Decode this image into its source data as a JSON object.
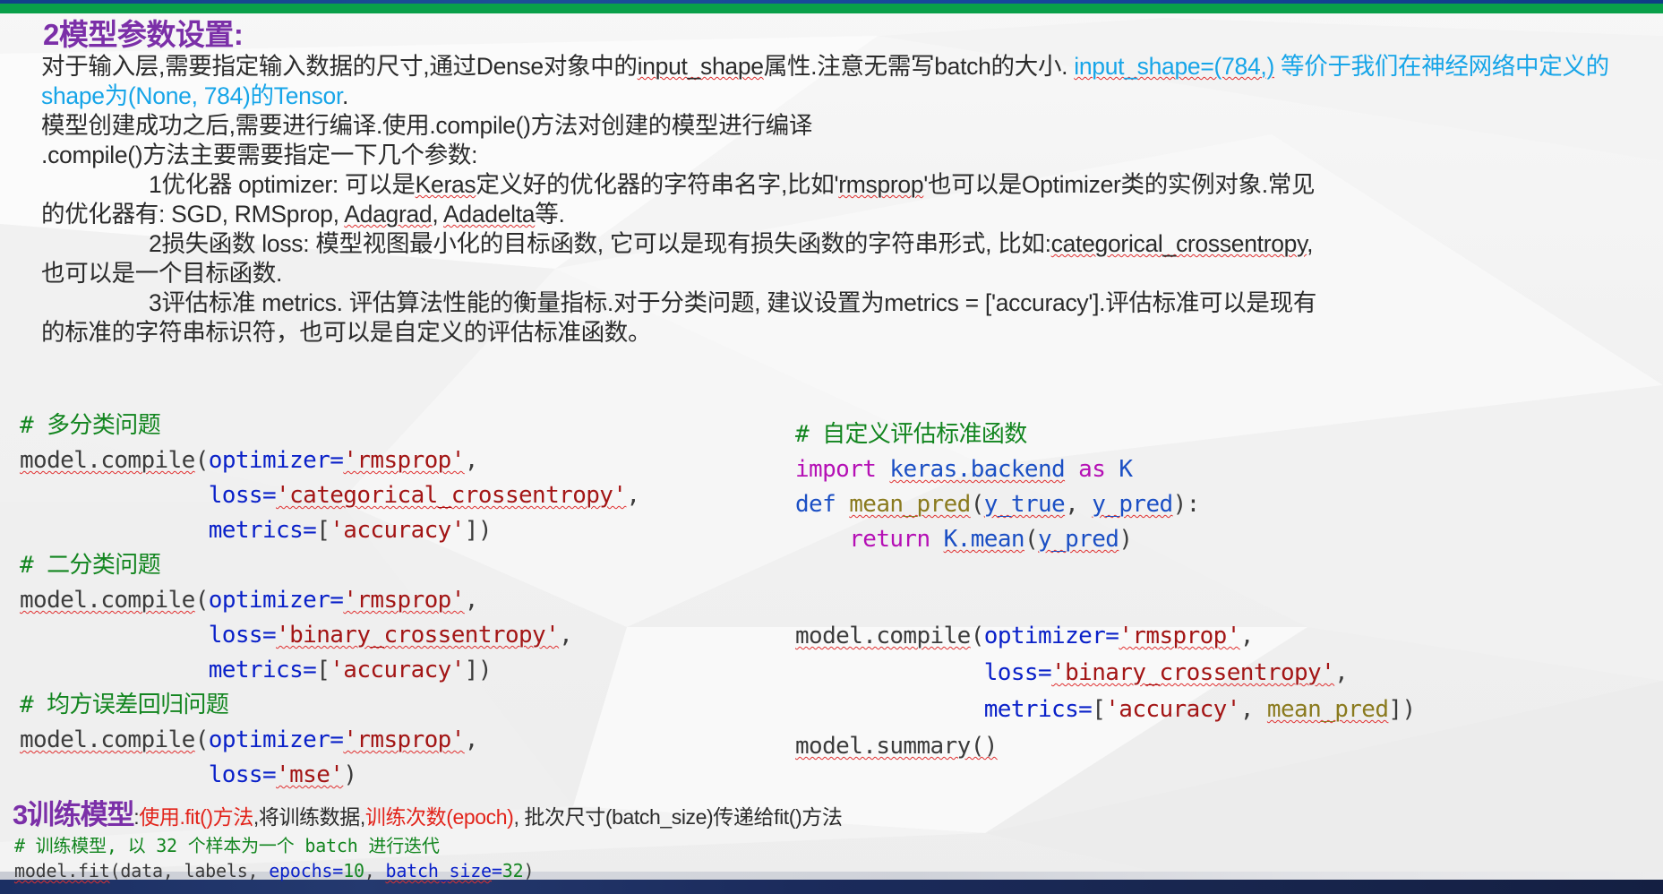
{
  "slide": {
    "accent_purple": "#7b2fa8",
    "accent_green": "#09a04a",
    "accent_navy": "#1b2f63",
    "link_blue": "#17a5e8",
    "alert_red": "#e2231a"
  },
  "heading2": "2模型参数设置:",
  "paragraph": {
    "line1_a": "对于输入层,需要指定输入数据的尺寸,通过Dense对象中的",
    "line1_b": "input_shape",
    "line1_c": "属性.注意无需写batch的大小. ",
    "line1_blue_a": "input_shape=(784,)",
    "line1_blue_b": " 等价于我们在神经网络中定义的shape为(None, 784)的Tensor",
    "line1_end": ".",
    "line2": "模型创建成功之后,需要进行编译.使用.compile()方法对创建的模型进行编译",
    "line3": ".compile()方法主要需要指定一下几个参数:",
    "item1_a": "1优化器 optimizer: 可以是",
    "item1_keras": "Keras",
    "item1_b": "定义好的优化器的字符串名字,比如'",
    "item1_rmsprop": "rmsprop",
    "item1_c": "'也可以是Optimizer类的实例对象.常见",
    "item1_d": "的优化器有: SGD, RMSprop, ",
    "item1_adagrad": "Adagrad",
    "item1_e": ", ",
    "item1_adadelta": "Adadelta",
    "item1_f": "等.",
    "item2_a": "2损失函数 loss: 模型视图最小化的目标函数, 它可以是现有损失函数的字符串形式, 比如:",
    "item2_cat": "categorical_crossentropy",
    "item2_b": ",",
    "item2_c": "也可以是一个目标函数.",
    "item3_a": "3评估标准 metrics. 评估算法性能的衡量指标.对于分类问题, 建议设置为metrics = ['accuracy'].评估标准可以是现有",
    "item3_b": "的标准的字符串标识符，也可以是自定义的评估标准函数。"
  },
  "code_left": {
    "comment1": "# 多分类问题",
    "b1_call": "model.compile",
    "b1_open": "(",
    "b1_kw1": "optimizer",
    "b1_eq": "=",
    "b1_s1": "'rmsprop'",
    "b1_comma": ",",
    "b1_kw2": "loss",
    "b1_s2": "'categorical_crossentropy'",
    "b1_kw3": "metrics",
    "b1_s3": "'accuracy'",
    "comment2": "# 二分类问题",
    "b2_s2": "'binary_crossentropy'",
    "comment3": "# 均方误差回归问题",
    "b3_s2": "'mse'",
    "lbrack": "[",
    "rbrack": "]",
    "rparen": ")"
  },
  "code_right": {
    "comment1": "# 自定义评估标准函数",
    "kw_import": "import",
    "mod_keras": "keras.backend",
    "kw_as": "as",
    "name_K": "K",
    "kw_def": "def",
    "fn_mean_pred": "mean_pred",
    "arg_y_true": "y_true",
    "arg_y_pred": "y_pred",
    "kw_return": "return",
    "mod_K": "K.mean",
    "call": "model.compile",
    "kw1": "optimizer",
    "s1": "'rmsprop'",
    "kw2": "loss",
    "s2": "'binary_crossentropy'",
    "kw3": "metrics",
    "s3": "'accuracy'",
    "metric_fn": "mean_pred",
    "summary": "model.summary()"
  },
  "heading3": {
    "title": "3训练模型",
    "colon": ":",
    "red1": "使用.fit()方法",
    "black1": ",将训练数据,",
    "red2": "训练次数(epoch)",
    "black2": ", 批次尺寸(batch_size)传递给fit()方法"
  },
  "code_bottom": {
    "comment": "# 训练模型, 以 32 个样本为一个 batch 进行迭代",
    "call": "model.fit",
    "arg1": "data",
    "arg2": "labels",
    "kw1": "epochs",
    "num1": "10",
    "kw2": "batch_size",
    "num2": "32"
  }
}
